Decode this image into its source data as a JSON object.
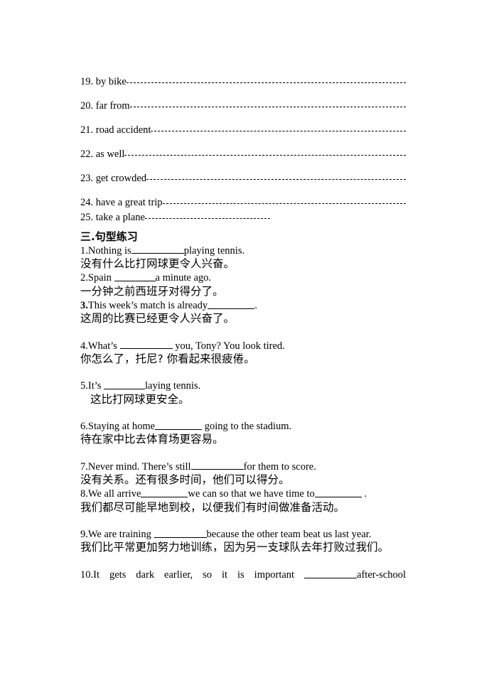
{
  "document": {
    "vocabulary": {
      "items": [
        {
          "label": "19. by bike",
          "line": "dash-dot",
          "length": "full"
        },
        {
          "label": "20. far from",
          "line": "dash-dot",
          "length": "full"
        },
        {
          "label": "21. road accident ",
          "line": "dash-dot",
          "length": "full"
        },
        {
          "label": "22. as well",
          "line": "dash-dot",
          "length": "full"
        },
        {
          "label": "23. get crowded ",
          "line": "dash-dot",
          "length": "full"
        },
        {
          "label": "24. have a great trip",
          "line": "dash-dot",
          "length": "full"
        },
        {
          "label": "25. take a plane",
          "line": "dash-dot",
          "length": "short"
        }
      ]
    },
    "section": {
      "heading": "三.句型练习"
    },
    "exercises": [
      {
        "number": "1.",
        "en_before": "Nothing is",
        "blank": "b-xl",
        "en_after": "playing tennis.",
        "zh": "没有什么比打网球更令人兴奋。",
        "bold_number": false,
        "zh_indent": false,
        "space_after": "none"
      },
      {
        "number": "2.",
        "en_before": "Spain ",
        "blank": "b-md",
        "en_after": "a minute ago.",
        "zh": "一分钟之前西班牙对得分了。",
        "bold_number": false,
        "zh_indent": false,
        "space_after": "none"
      },
      {
        "number": "3.",
        "en_before": "This week’s match is already",
        "blank": "b-lg",
        "en_after": ".",
        "zh": "这周的比赛已经更令人兴奋了。",
        "bold_number": true,
        "zh_indent": false,
        "space_after": "large"
      },
      {
        "number": "4.",
        "en_before": "What’s ",
        "blank": "b-xl",
        "en_after": " you, Tony? You look tired.",
        "zh": "你怎么了，托尼? 你看起来很疲倦。",
        "bold_number": false,
        "zh_indent": false,
        "space_after": "large"
      },
      {
        "number": "5.",
        "en_before": "It’s ",
        "blank": "b-md",
        "en_after": "laying tennis.",
        "zh": "这比打网球更安全。",
        "bold_number": false,
        "zh_indent": true,
        "space_after": "large"
      },
      {
        "number": "6.",
        "en_before": "Staying at home",
        "blank": "b-lg",
        "en_after": " going to the stadium.",
        "zh": "待在家中比去体育场更容易。",
        "bold_number": false,
        "zh_indent": false,
        "space_after": "large"
      },
      {
        "number": "7.",
        "en_before": "Never mind. There’s  still",
        "blank": "b-xl",
        "en_after": "for them to score.",
        "zh": "没有关系。还有很多时间，他们可以得分。",
        "bold_number": false,
        "zh_indent": false,
        "space_after": "none"
      },
      {
        "number": "8.",
        "en_before": "We all  arrive",
        "blank": "b-lg",
        "en_mid": "we can so that we have time to",
        "blank2": "b-lg",
        "en_after": " .",
        "zh": "我们都尽可能早地到校，以便我们有时间做准备活动。",
        "bold_number": false,
        "zh_indent": false,
        "space_after": "large"
      },
      {
        "number": "9.",
        "en_before": "We are training  ",
        "blank": "b-xl",
        "en_after": "because the other team beat us last year.",
        "zh": "我们比平常更加努力地训练，因为另一支球队去年打败过我们。",
        "bold_number": false,
        "zh_indent": false,
        "space_after": "large"
      }
    ],
    "last_exercise": {
      "number": "10.",
      "en_before": "It gets dark earlier, so it is important ",
      "blank": "b-xl",
      "en_after": "after-school"
    }
  }
}
